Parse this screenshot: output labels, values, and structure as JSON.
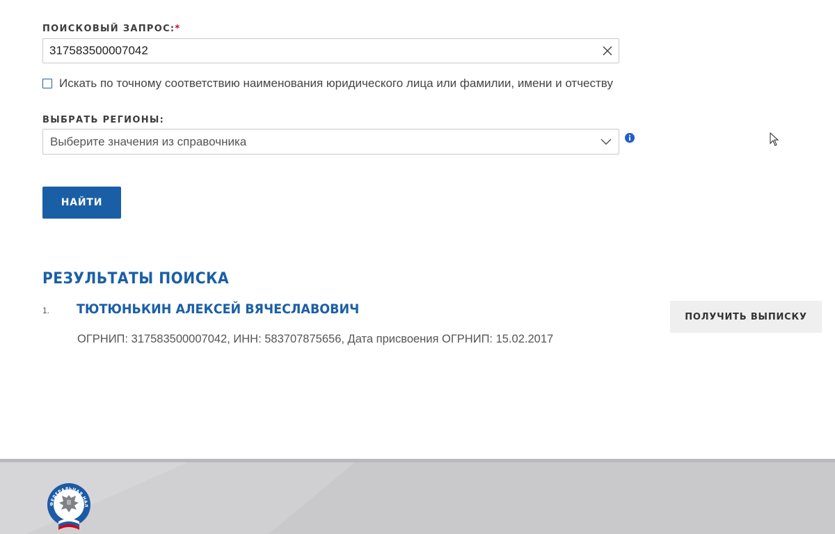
{
  "search": {
    "label": "ПОИСКОВЫЙ ЗАПРОС:",
    "required_mark": "*",
    "value": "317583500007042"
  },
  "exact_match": {
    "label": "Искать по точному соответствию наименования юридического лица или фамилии, имени и отчеству",
    "checked": false
  },
  "regions": {
    "label": "ВЫБРАТЬ РЕГИОНЫ:",
    "placeholder": "Выберите значения из справочника"
  },
  "find_button": {
    "label": "НАЙТИ"
  },
  "results": {
    "title": "РЕЗУЛЬТАТЫ ПОИСКА",
    "items": [
      {
        "index": "1.",
        "name": "ТЮТЮНЬКИН АЛЕКСЕЙ ВЯЧЕСЛАВОВИЧ",
        "details": "ОГРНИП: 317583500007042, ИНН: 583707875656, Дата присвоения ОГРНИП: 15.02.2017",
        "action_label": "ПОЛУЧИТЬ ВЫПИСКУ"
      }
    ]
  },
  "footer": {
    "logo_text": "ФЕДЕРАЛЬНАЯ НАЛОГОВАЯ СЛУЖБА"
  },
  "colors": {
    "accent": "#1a5fa6",
    "required": "#d0021b",
    "footer_bg": "#c9c9cb"
  },
  "icons": [
    "clear-icon",
    "chevron-down-icon",
    "info-icon",
    "emblem-logo",
    "mouse-cursor"
  ]
}
